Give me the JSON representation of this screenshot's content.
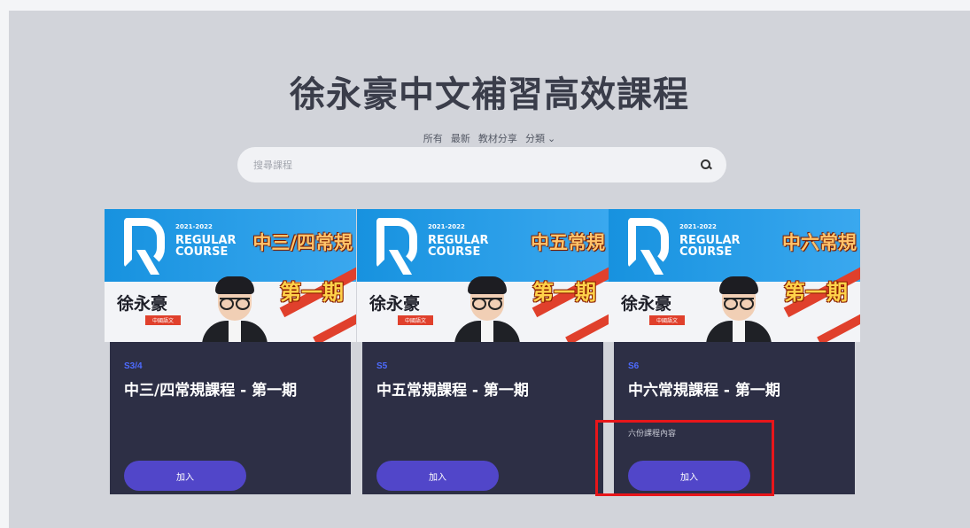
{
  "header": {
    "title": "徐永豪中文補習高效課程"
  },
  "filters": [
    {
      "label": "所有"
    },
    {
      "label": "最新"
    },
    {
      "label": "教材分享"
    },
    {
      "label": "分類 ⌄"
    }
  ],
  "search": {
    "placeholder": "搜尋課程",
    "icon": "search-icon"
  },
  "cards": [
    {
      "banner_year": "2021-2022",
      "banner_regular": "REGULAR",
      "banner_course": "COURSE",
      "banner_level": "中三/四常規",
      "banner_period": "第一期",
      "teacher_name": "徐永豪",
      "subject": "中國語文",
      "code": "S3/4",
      "title": "中三/四常規課程 - 第一期",
      "info": "",
      "join_label": "加入"
    },
    {
      "banner_year": "2021-2022",
      "banner_regular": "REGULAR",
      "banner_course": "COURSE",
      "banner_level": "中五常規",
      "banner_period": "第一期",
      "teacher_name": "徐永豪",
      "subject": "中國語文",
      "code": "S5",
      "title": "中五常規課程 - 第一期",
      "info": "",
      "join_label": "加入"
    },
    {
      "banner_year": "2021-2022",
      "banner_regular": "REGULAR",
      "banner_course": "COURSE",
      "banner_level": "中六常規",
      "banner_period": "第一期",
      "teacher_name": "徐永豪",
      "subject": "中國語文",
      "code": "S6",
      "title": "中六常規課程 - 第一期",
      "info": "六份課程內容",
      "join_label": "加入"
    }
  ],
  "colors": {
    "accent": "#5146c9",
    "card_bg": "#2d2f45",
    "highlight": "#e8161a"
  }
}
